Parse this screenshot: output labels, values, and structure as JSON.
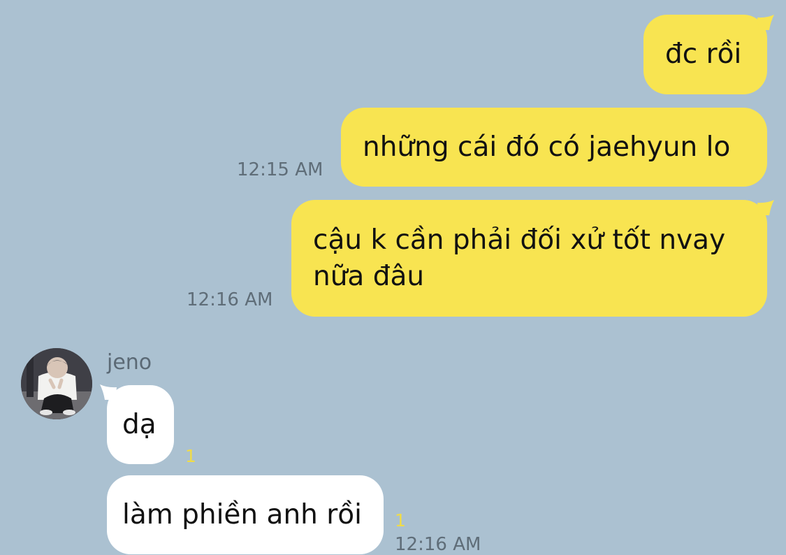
{
  "theme": {
    "background": "#abc1d1",
    "my_bubble": "#f8e451",
    "their_bubble": "#ffffff",
    "timestamp_color": "#5f6d78",
    "unread_color": "#f1dc46"
  },
  "messages": {
    "m1": {
      "text": "đc rồi",
      "direction": "sent"
    },
    "m2": {
      "text": "những cái đó có jaehyun lo",
      "direction": "sent",
      "time": "12:15 AM"
    },
    "m3": {
      "line1": "cậu k cần phải đối xử tốt nvay",
      "line2": "nữa đâu",
      "direction": "sent",
      "time": "12:16 AM"
    }
  },
  "contact": {
    "name": "jeno",
    "avatar": "profile-photo-icon"
  },
  "replies": {
    "r1": {
      "text": "dạ",
      "direction": "received",
      "unread": "1"
    },
    "r2": {
      "text": "làm phiền anh rồi",
      "direction": "received",
      "unread": "1",
      "time": "12:16 AM"
    }
  }
}
